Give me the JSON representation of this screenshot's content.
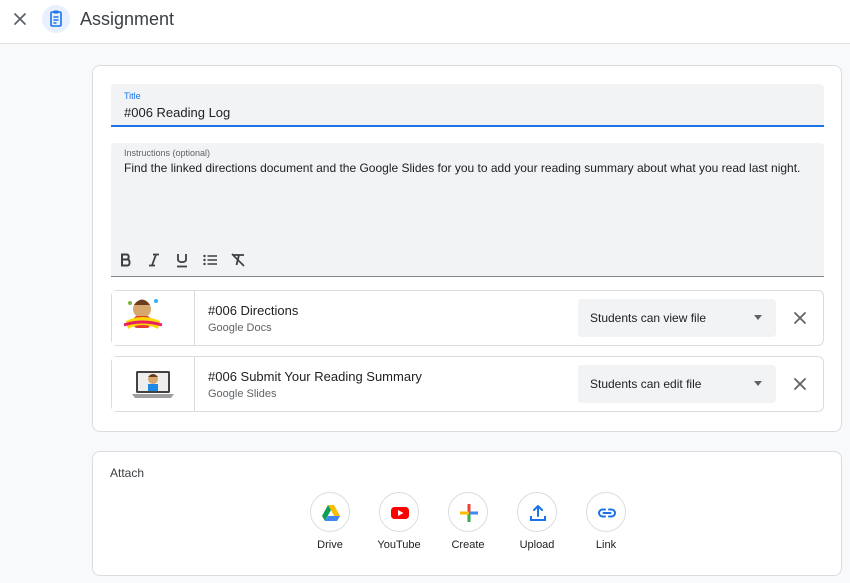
{
  "header": {
    "title": "Assignment"
  },
  "form": {
    "title_label": "Title",
    "title_value": "#006 Reading Log",
    "instructions_label": "Instructions (optional)",
    "instructions_value": "Find the linked directions document and the Google Slides for you to add your reading summary about what you read last night."
  },
  "toolbar": [
    "bold-icon",
    "italic-icon",
    "underline-icon",
    "bulleted-list-icon",
    "clear-formatting-icon"
  ],
  "attachments": [
    {
      "name": "#006 Directions",
      "type": "Google Docs",
      "permission": "Students can view file"
    },
    {
      "name": "#006 Submit Your Reading Summary",
      "type": "Google Slides",
      "permission": "Students can edit file"
    }
  ],
  "attach": {
    "label": "Attach",
    "buttons": [
      {
        "label": "Drive",
        "icon": "google-drive-icon"
      },
      {
        "label": "YouTube",
        "icon": "youtube-icon"
      },
      {
        "label": "Create",
        "icon": "create-plus-icon"
      },
      {
        "label": "Upload",
        "icon": "upload-icon"
      },
      {
        "label": "Link",
        "icon": "link-icon"
      }
    ]
  },
  "colors": {
    "accent": "#1a73e8",
    "youtube": "#ff0000"
  }
}
